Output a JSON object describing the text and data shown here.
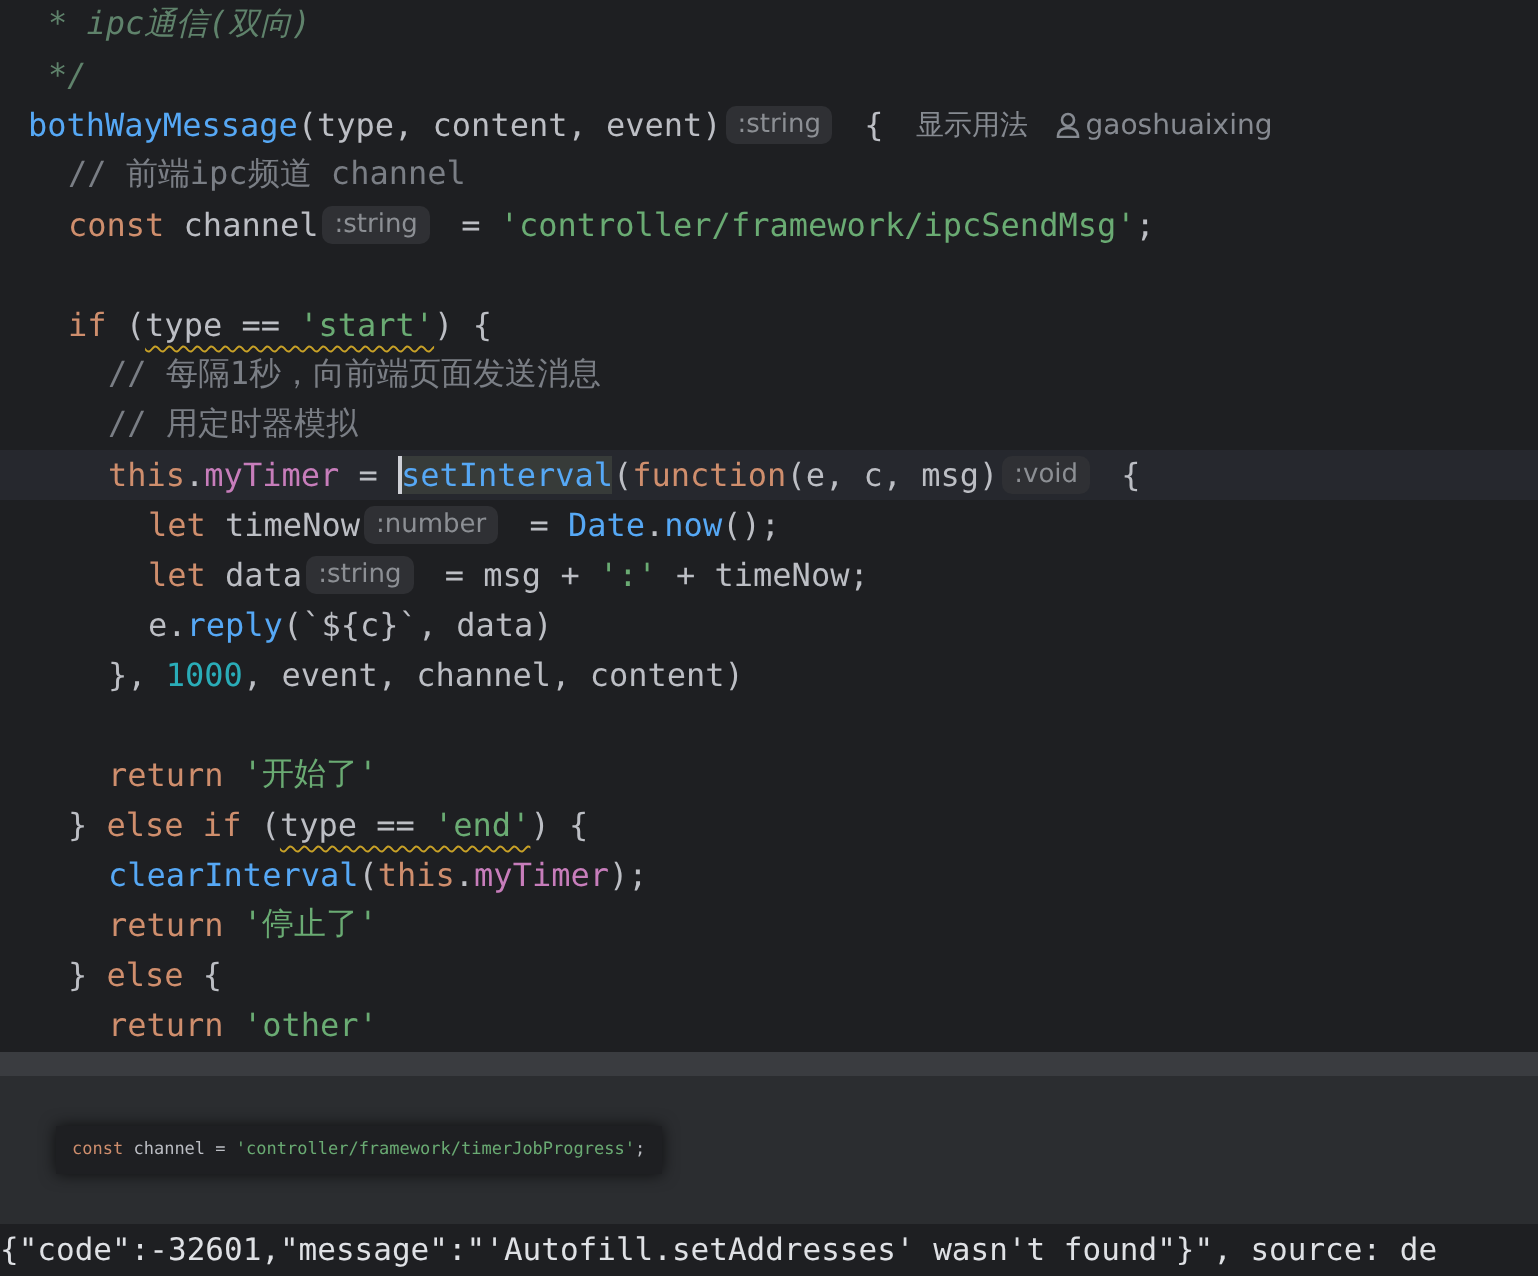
{
  "editor": {
    "lines": [
      {
        "tokens": [
          {
            "kind": "doc",
            "t": "* ipc通信(双向)"
          }
        ]
      },
      {
        "tokens": [
          {
            "kind": "doc",
            "t": "*/"
          }
        ]
      },
      {
        "tokens": [
          {
            "kind": "fn",
            "t": "bothWayMessage"
          },
          {
            "kind": "ident",
            "t": "(type, content, event)"
          },
          {
            "kind": "hint",
            "t": ":string"
          },
          {
            "kind": "ident",
            "t": " {"
          },
          {
            "kind": "lens",
            "t": "显示用法"
          },
          {
            "kind": "author",
            "t": "gaoshuaixing"
          }
        ],
        "children": [
          {
            "tokens": [
              {
                "kind": "comment",
                "t": "// 前端ipc频道 channel"
              }
            ]
          },
          {
            "tokens": [
              {
                "kind": "kw",
                "t": "const "
              },
              {
                "kind": "ident",
                "t": "channel"
              },
              {
                "kind": "hint",
                "t": ":string"
              },
              {
                "kind": "ident",
                "t": " = "
              },
              {
                "kind": "str",
                "t": "'controller/framework/ipcSendMsg'"
              },
              {
                "kind": "ident",
                "t": ";"
              }
            ]
          },
          {
            "kind": "blank"
          },
          {
            "tokens": [
              {
                "kind": "kw",
                "t": "if "
              },
              {
                "kind": "ident",
                "t": "("
              },
              {
                "kind": "ident",
                "t": "type == ",
                "warn": true
              },
              {
                "kind": "str",
                "t": "'start'",
                "warn": true
              },
              {
                "kind": "ident",
                "t": ") {"
              }
            ],
            "children": [
              {
                "tokens": [
                  {
                    "kind": "comment",
                    "t": "// 每隔1秒，向前端页面发送消息"
                  }
                ]
              },
              {
                "tokens": [
                  {
                    "kind": "comment",
                    "t": "// 用定时器模拟"
                  }
                ]
              },
              {
                "current": true,
                "tokens": [
                  {
                    "kind": "kw",
                    "t": "this"
                  },
                  {
                    "kind": "ident",
                    "t": "."
                  },
                  {
                    "kind": "field",
                    "t": "myTimer"
                  },
                  {
                    "kind": "ident",
                    "t": " = "
                  },
                  {
                    "kind": "fn",
                    "t": "setInterval",
                    "caret": true,
                    "highlight": true
                  },
                  {
                    "kind": "ident",
                    "t": "("
                  },
                  {
                    "kind": "kw",
                    "t": "function"
                  },
                  {
                    "kind": "ident",
                    "t": "(e, c, msg)"
                  },
                  {
                    "kind": "hint",
                    "t": ":void"
                  },
                  {
                    "kind": "ident",
                    "t": " {"
                  }
                ],
                "children": [
                  {
                    "tokens": [
                      {
                        "kind": "kw",
                        "t": "let "
                      },
                      {
                        "kind": "ident",
                        "t": "timeNow"
                      },
                      {
                        "kind": "hint",
                        "t": ":number"
                      },
                      {
                        "kind": "ident",
                        "t": " = "
                      },
                      {
                        "kind": "fn",
                        "t": "Date"
                      },
                      {
                        "kind": "ident",
                        "t": "."
                      },
                      {
                        "kind": "fn",
                        "t": "now"
                      },
                      {
                        "kind": "ident",
                        "t": "();"
                      }
                    ]
                  },
                  {
                    "tokens": [
                      {
                        "kind": "kw",
                        "t": "let "
                      },
                      {
                        "kind": "ident",
                        "t": "data"
                      },
                      {
                        "kind": "hint",
                        "t": ":string"
                      },
                      {
                        "kind": "ident",
                        "t": " = msg + "
                      },
                      {
                        "kind": "str",
                        "t": "':'"
                      },
                      {
                        "kind": "ident",
                        "t": " + timeNow;"
                      }
                    ]
                  },
                  {
                    "tokens": [
                      {
                        "kind": "ident",
                        "t": "e."
                      },
                      {
                        "kind": "fn",
                        "t": "reply"
                      },
                      {
                        "kind": "ident",
                        "t": "(`${c}`, data)"
                      }
                    ]
                  }
                ]
              },
              {
                "tokens": [
                  {
                    "kind": "ident",
                    "t": "}, "
                  },
                  {
                    "kind": "num",
                    "t": "1000"
                  },
                  {
                    "kind": "ident",
                    "t": ", event, channel, content)"
                  }
                ]
              },
              {
                "kind": "blank"
              },
              {
                "tokens": [
                  {
                    "kind": "kw",
                    "t": "return "
                  },
                  {
                    "kind": "str",
                    "t": "'开始了'"
                  }
                ]
              }
            ]
          },
          {
            "tokens": [
              {
                "kind": "ident",
                "t": "} "
              },
              {
                "kind": "kw",
                "t": "else if "
              },
              {
                "kind": "ident",
                "t": "("
              },
              {
                "kind": "ident",
                "t": "type == ",
                "warn": true
              },
              {
                "kind": "str",
                "t": "'end'",
                "warn": true
              },
              {
                "kind": "ident",
                "t": ") {"
              }
            ],
            "children": [
              {
                "tokens": [
                  {
                    "kind": "fn",
                    "t": "clearInterval"
                  },
                  {
                    "kind": "ident",
                    "t": "("
                  },
                  {
                    "kind": "kw",
                    "t": "this"
                  },
                  {
                    "kind": "ident",
                    "t": "."
                  },
                  {
                    "kind": "field",
                    "t": "myTimer"
                  },
                  {
                    "kind": "ident",
                    "t": ");"
                  }
                ]
              },
              {
                "tokens": [
                  {
                    "kind": "kw",
                    "t": "return "
                  },
                  {
                    "kind": "str",
                    "t": "'停止了'"
                  }
                ]
              }
            ]
          },
          {
            "tokens": [
              {
                "kind": "ident",
                "t": "} "
              },
              {
                "kind": "kw",
                "t": "else"
              },
              {
                "kind": "ident",
                "t": " {"
              }
            ],
            "children": [
              {
                "tokens": [
                  {
                    "kind": "kw",
                    "t": "return "
                  },
                  {
                    "kind": "str",
                    "t": "'other'"
                  }
                ]
              }
            ]
          }
        ]
      }
    ]
  },
  "popup": {
    "tokens": [
      {
        "kind": "kw",
        "t": "const "
      },
      {
        "kind": "ident",
        "t": "channel = "
      },
      {
        "kind": "str",
        "t": "'controller/framework/timerJobProgress'"
      },
      {
        "kind": "ident",
        "t": ";"
      }
    ]
  },
  "console": {
    "text": "{\"code\":-32601,\"message\":\"'Autofill.setAddresses' wasn't found\"}\", source: de"
  }
}
